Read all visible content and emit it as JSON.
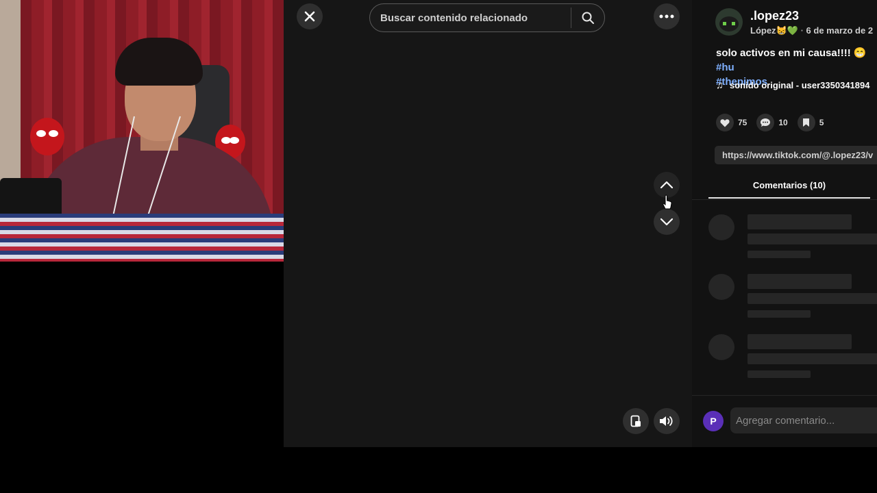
{
  "search": {
    "placeholder": "Buscar contenido relacionado"
  },
  "post": {
    "username": ".lopez23",
    "display_name": "López😸💚",
    "date_sep": "·",
    "date": "6 de marzo de 2",
    "caption_text": "solo activos en mi causa!!!! 😁 ",
    "hashtag_1": "#hu",
    "hashtag_2": "#thepimos",
    "sound": "sonido original - user3350341894"
  },
  "stats": {
    "likes": "75",
    "comments": "10",
    "saves": "5"
  },
  "share_url": "https://www.tiktok.com/@.lopez23/v",
  "tabs": {
    "comments_label": "Comentarios (10)"
  },
  "comment_box": {
    "placeholder": "Agregar comentario...",
    "user_initial": "P"
  },
  "colors": {
    "accent_hashtag": "#7fb0ff",
    "user_avatar": "#5a2fb8"
  },
  "icons": {
    "close": "close-icon",
    "search": "search-icon",
    "more": "more-icon",
    "nav_up": "chevron-up-icon",
    "nav_down": "chevron-down-icon",
    "mini_player": "mini-player-icon",
    "volume": "volume-icon",
    "like": "heart-icon",
    "comment": "comment-icon",
    "save": "bookmark-icon",
    "music": "music-note-icon"
  }
}
